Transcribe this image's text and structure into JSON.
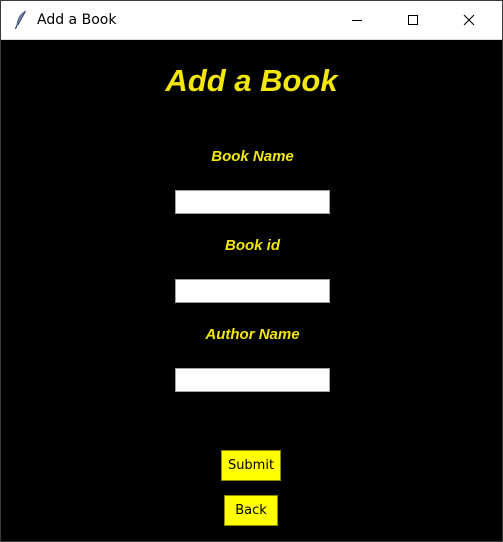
{
  "window": {
    "title": "Add a Book",
    "controls": {
      "minimize_icon": "minimize-icon",
      "maximize_icon": "maximize-icon",
      "close_icon": "close-icon"
    }
  },
  "form": {
    "heading": "Add a Book",
    "fields": [
      {
        "label": "Book Name",
        "value": ""
      },
      {
        "label": "Book id",
        "value": ""
      },
      {
        "label": "Author Name",
        "value": ""
      }
    ],
    "submit_label": "Submit",
    "back_label": "Back"
  },
  "colors": {
    "background": "#000000",
    "text_accent": "#f2e60a",
    "button_bg": "#ffff00",
    "entry_bg": "#ffffff"
  }
}
